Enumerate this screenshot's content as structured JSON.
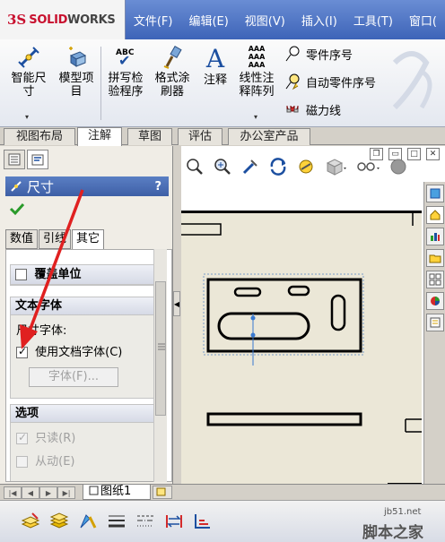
{
  "app": {
    "logo_ds": "3S",
    "logo_text": "SOLID",
    "logo_text_bold": "WORKS"
  },
  "menu": [
    "文件(F)",
    "编辑(E)",
    "视图(V)",
    "插入(I)",
    "工具(T)",
    "窗口("
  ],
  "ribbon": {
    "smart_dim_line1": "智能尺",
    "smart_dim_line2": "寸",
    "model_items_line1": "模型项",
    "model_items_line2": "目",
    "spell_line1": "拼写检",
    "spell_line2": "验程序",
    "format_line1": "格式涂",
    "format_line2": "刷器",
    "note": "注释",
    "linear_line1": "线性注",
    "linear_line2": "释阵列",
    "balloon": "零件序号",
    "auto_balloon": "自动零件序号",
    "magnetic_line": "磁力线",
    "abc": "ABC",
    "aaa": "AAA"
  },
  "tabs": [
    "视图布局",
    "注解",
    "草图",
    "评估",
    "办公室产品"
  ],
  "active_tab": "注解",
  "panel": {
    "title": "尺寸",
    "help": "?",
    "subtabs": [
      "数值",
      "引线",
      "其它"
    ],
    "active_subtab": "其它",
    "override_units": "覆盖单位",
    "text_font_group": "文本字体",
    "dim_font_label": "尺寸字体:",
    "use_doc_font": "使用文档字体(C)",
    "font_button": "字体(F)...",
    "options_group": "选项",
    "read_only": "只读(R)",
    "driven": "从动(E)"
  },
  "sheet_tab": "图纸1",
  "watermark": {
    "url": "jb51.net",
    "name": "脚本之家"
  },
  "colors": {
    "accent_blue": "#3e5fa6",
    "arrow_red": "#e02020",
    "sheet_bg": "#ebe7d7",
    "logo_red": "#c8102e"
  }
}
